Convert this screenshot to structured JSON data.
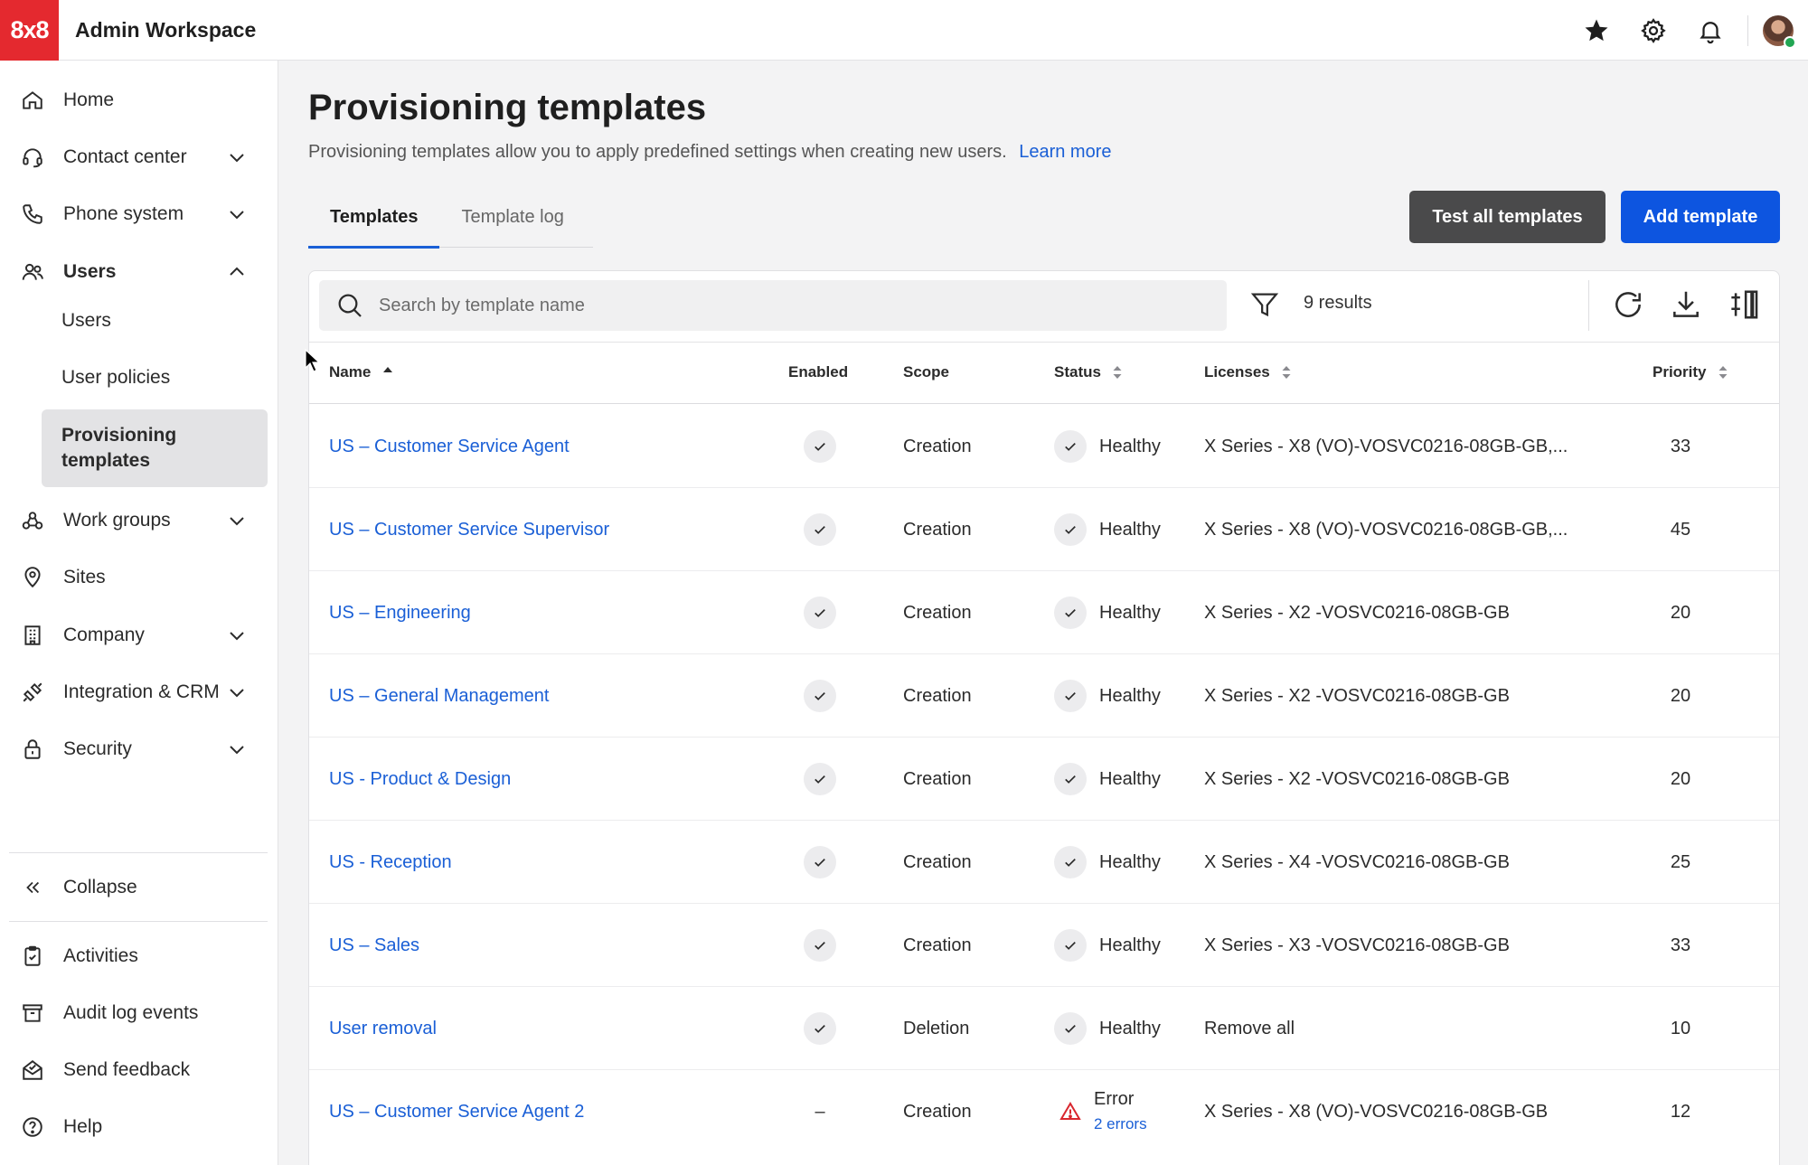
{
  "app": {
    "logo": "8x8",
    "title": "Admin Workspace"
  },
  "topbar": {
    "icons": [
      "star-icon",
      "gear-icon",
      "bell-icon",
      "avatar"
    ]
  },
  "sidebar": {
    "items": [
      {
        "label": "Home",
        "icon": "home-icon"
      },
      {
        "label": "Contact center",
        "icon": "headset-icon"
      },
      {
        "label": "Phone system",
        "icon": "phone-icon"
      },
      {
        "label": "Users",
        "icon": "users-icon"
      },
      {
        "label": "Work groups",
        "icon": "workgroups-icon"
      },
      {
        "label": "Sites",
        "icon": "location-pin-icon"
      },
      {
        "label": "Company",
        "icon": "building-icon"
      },
      {
        "label": "Integration & CRM",
        "icon": "integration-icon"
      },
      {
        "label": "Security",
        "icon": "lock-icon"
      }
    ],
    "users_sub": [
      "Users",
      "User policies",
      "Provisioning templates"
    ],
    "collapse": "Collapse",
    "footer": [
      {
        "label": "Activities",
        "icon": "clipboard-icon"
      },
      {
        "label": "Audit log events",
        "icon": "archive-icon"
      },
      {
        "label": "Send feedback",
        "icon": "feedback-icon"
      },
      {
        "label": "Help",
        "icon": "help-icon"
      }
    ]
  },
  "page": {
    "title": "Provisioning templates",
    "description": "Provisioning templates allow you to apply predefined settings when creating new users.",
    "learn_more": "Learn more",
    "tabs": [
      "Templates",
      "Template log"
    ],
    "active_tab": "Templates",
    "buttons": {
      "test_all": "Test all templates",
      "add": "Add template"
    }
  },
  "toolbar": {
    "search_placeholder": "Search by template name",
    "results": "9 results"
  },
  "table": {
    "headers": {
      "name": "Name",
      "enabled": "Enabled",
      "scope": "Scope",
      "status": "Status",
      "licenses": "Licenses",
      "priority": "Priority"
    },
    "rows": [
      {
        "name": "US – Customer Service Agent",
        "enabled": true,
        "scope": "Creation",
        "status": "Healthy",
        "license": "X Series - X8 (VO)-VOSVC0216-08GB-GB,...",
        "priority": "33"
      },
      {
        "name": "US – Customer Service Supervisor",
        "enabled": true,
        "scope": "Creation",
        "status": "Healthy",
        "license": "X Series - X8 (VO)-VOSVC0216-08GB-GB,...",
        "priority": "45"
      },
      {
        "name": "US – Engineering",
        "enabled": true,
        "scope": "Creation",
        "status": "Healthy",
        "license": "X Series - X2 -VOSVC0216-08GB-GB",
        "priority": "20"
      },
      {
        "name": "US – General Management",
        "enabled": true,
        "scope": "Creation",
        "status": "Healthy",
        "license": "X Series - X2 -VOSVC0216-08GB-GB",
        "priority": "20"
      },
      {
        "name": "US - Product & Design",
        "enabled": true,
        "scope": "Creation",
        "status": "Healthy",
        "license": "X Series - X2 -VOSVC0216-08GB-GB",
        "priority": "20"
      },
      {
        "name": "US - Reception",
        "enabled": true,
        "scope": "Creation",
        "status": "Healthy",
        "license": "X Series - X4 -VOSVC0216-08GB-GB",
        "priority": "25"
      },
      {
        "name": "US – Sales",
        "enabled": true,
        "scope": "Creation",
        "status": "Healthy",
        "license": "X Series - X3 -VOSVC0216-08GB-GB",
        "priority": "33"
      },
      {
        "name": "User removal",
        "enabled": true,
        "scope": "Deletion",
        "status": "Healthy",
        "license": "Remove all",
        "priority": "10"
      },
      {
        "name": "US – Customer Service Agent 2",
        "enabled": false,
        "enabled_text": "–",
        "scope": "Creation",
        "status": "Error",
        "status_detail": "2 errors",
        "license": "X Series - X8 (VO)-VOSVC0216-08GB-GB",
        "priority": "12"
      }
    ]
  },
  "colors": {
    "brand": "#e4292f",
    "primary": "#0d55e0",
    "link": "#1a5fd6",
    "dark_button": "#4a4a4b",
    "error": "#d9272e"
  }
}
